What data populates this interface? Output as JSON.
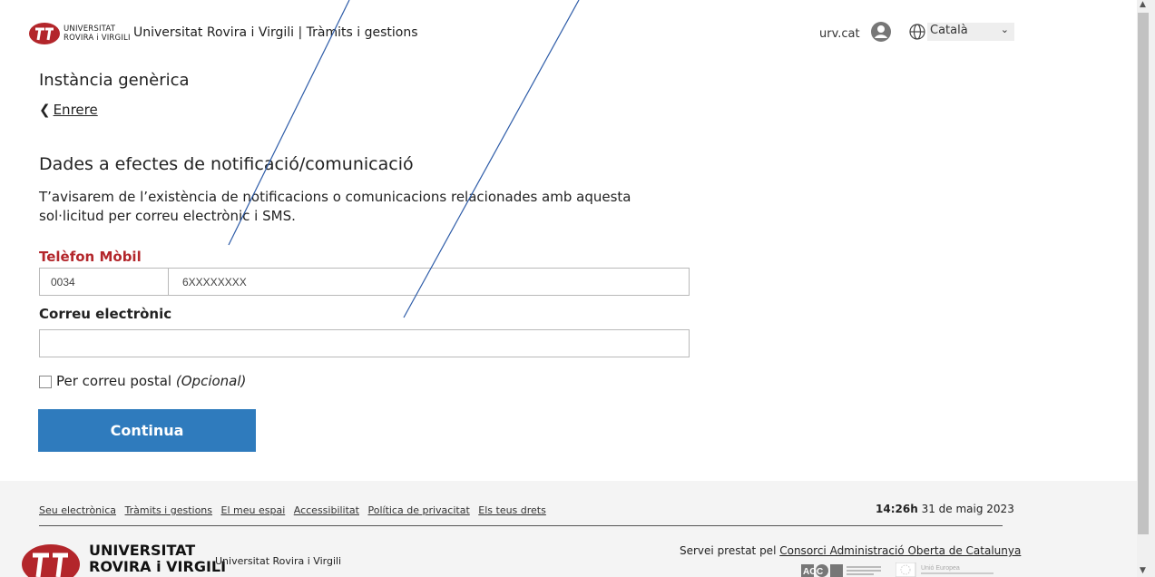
{
  "header": {
    "logo_line1": "UNIVERSITAT",
    "logo_line2": "ROVIRA i VIRGILI",
    "site_title": "Universitat Rovira i Virgili | Tràmits i gestions",
    "urv_link": "urv.cat",
    "language": "Català"
  },
  "main": {
    "page_title": "Instància genèrica",
    "back_label": "Enrere",
    "section_title": "Dades a efectes de notificació/comunicació",
    "section_desc": "T’avisarem de l’existència de notificacions o comunicacions relacionades amb aquesta sol·licitud per correu electrònic i SMS.",
    "phone_label": "Telèfon Mòbil",
    "phone_prefix": "0034",
    "phone_number": "6XXXXXXXX",
    "email_label": "Correu electrònic",
    "email_value": "",
    "postal_label": "Per correu postal",
    "postal_optional": "(Opcional)",
    "postal_checked": false,
    "continue_label": "Continua"
  },
  "footer": {
    "links": [
      "Seu electrònica",
      "Tràmits i gestions",
      "El meu espai",
      "Accessibilitat",
      "Política de privacitat",
      "Els teus drets"
    ],
    "time": "14:26h",
    "date": "31 de maig 2023",
    "logo_line1": "UNIVERSITAT",
    "logo_line2": "ROVIRA i VIRGILI",
    "university_name": "Universitat Rovira i Virgili",
    "service_prefix": "Servei prestat pel",
    "service_link": "Consorci Administració Oberta de Catalunya",
    "aoc_text": "AOC",
    "eu_text": "Unió Europea"
  },
  "colors": {
    "accent": "#2f7bbd",
    "required_label": "#b3262b",
    "logo_red": "#b3262b",
    "footer_bg": "#f4f4f4"
  },
  "icons": [
    "urv-logo-icon",
    "user-icon",
    "globe-icon",
    "chevron-down-icon",
    "chevron-left-icon"
  ]
}
